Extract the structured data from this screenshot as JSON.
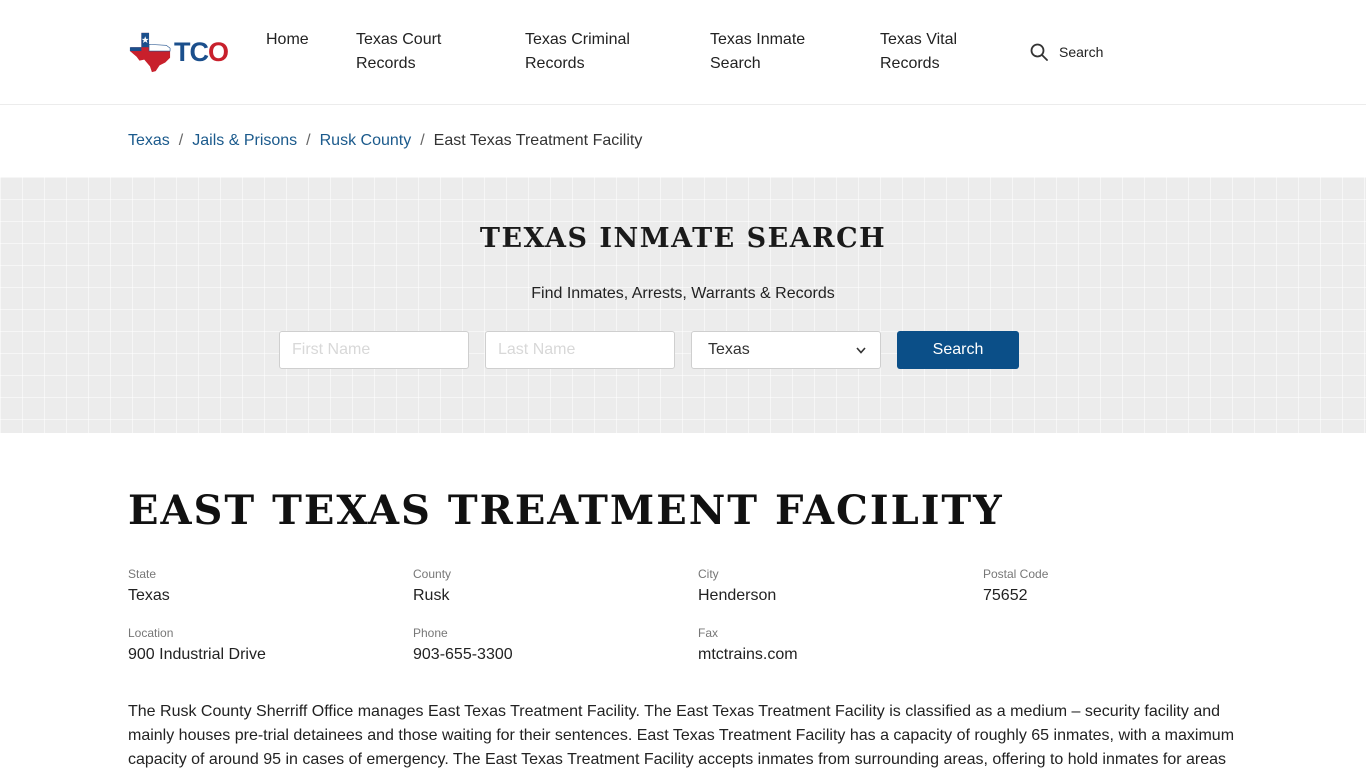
{
  "header": {
    "logo_text_t": "T",
    "logo_text_c": "C",
    "logo_text_o": "O",
    "logo_icon": "texas-flag-map-icon",
    "nav": [
      {
        "label": "Home"
      },
      {
        "label": "Texas Court Records"
      },
      {
        "label": "Texas Criminal Records"
      },
      {
        "label": "Texas Inmate Search"
      },
      {
        "label": "Texas Vital Records"
      }
    ],
    "search_label": "Search",
    "search_icon": "search-icon"
  },
  "breadcrumb": {
    "items": [
      "Texas",
      "Jails & Prisons",
      "Rusk County"
    ],
    "separator": "/",
    "current": "East Texas Treatment Facility"
  },
  "hero": {
    "title": "TEXAS INMATE SEARCH",
    "subtitle": "Find Inmates, Arrests, Warrants & Records",
    "first_name_placeholder": "First Name",
    "last_name_placeholder": "Last Name",
    "state_selected": "Texas",
    "button_label": "Search"
  },
  "facility": {
    "title": "EAST TEXAS TREATMENT FACILITY",
    "fields": [
      {
        "label": "State",
        "value": "Texas"
      },
      {
        "label": "County",
        "value": "Rusk"
      },
      {
        "label": "City",
        "value": "Henderson"
      },
      {
        "label": "Postal Code",
        "value": "75652"
      },
      {
        "label": "Location",
        "value": "900 Industrial Drive"
      },
      {
        "label": "Phone",
        "value": "903-655-3300"
      },
      {
        "label": "Fax",
        "value": "mtctrains.com"
      }
    ],
    "description": "The Rusk County Sherriff Office manages East Texas Treatment Facility. The East Texas Treatment Facility is classified as a medium – security facility and mainly houses pre-trial detainees and those waiting for their sentences. East Texas Treatment Facility has a capacity of roughly 65 inmates, with a maximum capacity of around 95 in cases of emergency. The East Texas Treatment Facility accepts inmates from surrounding areas, offering to hold inmates for areas"
  },
  "colors": {
    "brand_blue": "#0b4f88",
    "brand_red": "#c8202c",
    "link_blue": "#1b5a8c"
  }
}
